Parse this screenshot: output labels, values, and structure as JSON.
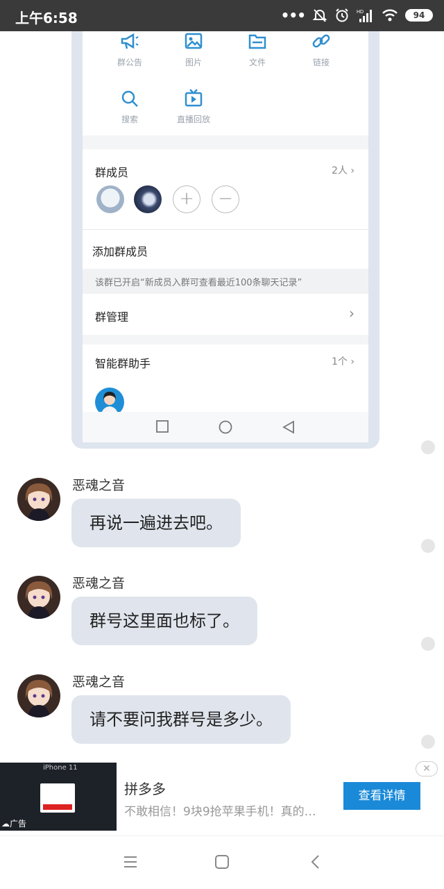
{
  "status_bar": {
    "time": "上午6:58",
    "battery": "94"
  },
  "shared_screenshot": {
    "quick_actions": [
      {
        "label": "群公告",
        "icon": "megaphone-icon"
      },
      {
        "label": "图片",
        "icon": "image-icon"
      },
      {
        "label": "文件",
        "icon": "folder-icon"
      },
      {
        "label": "链接",
        "icon": "link-icon"
      },
      {
        "label": "搜索",
        "icon": "search-icon"
      },
      {
        "label": "直播回放",
        "icon": "tv-play-icon"
      }
    ],
    "members": {
      "title": "群成员",
      "count": "2人",
      "add_label": "+",
      "remove_label": "−"
    },
    "add_member": "添加群成员",
    "notice": "该群已开启“新成员入群可查看最近100条聊天记录”",
    "manage": {
      "title": "群管理",
      "chevron": "›"
    },
    "assistant": {
      "title": "智能群助手",
      "count": "1个"
    },
    "accent_color": "#2f8fd0"
  },
  "messages": [
    {
      "sender": "恶魂之音",
      "text": "再说一遍进去吧。"
    },
    {
      "sender": "恶魂之音",
      "text": "群号这里面也标了。"
    },
    {
      "sender": "恶魂之音",
      "text": "请不要问我群号是多少。"
    }
  ],
  "ad": {
    "thumb_label": "iPhone 11",
    "tag": "广告",
    "title": "拼多多",
    "description": "不敢相信！9块9抢苹果手机！真的…",
    "button": "查看详情",
    "close": "✕",
    "button_color": "#1a8ad8"
  },
  "nav": {
    "menu_icon": "menu-icon",
    "home_icon": "home-square-icon",
    "back_icon": "back-chevron-icon"
  }
}
